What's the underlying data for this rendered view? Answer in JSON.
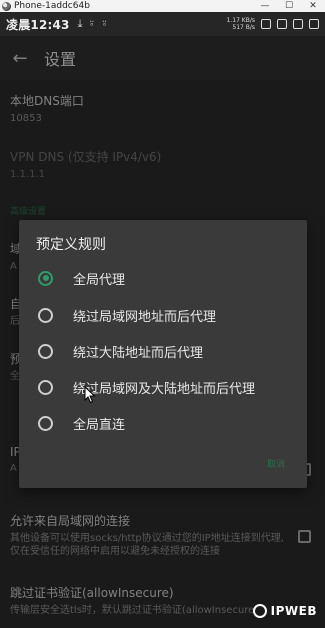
{
  "window": {
    "title": "Phone-1addc64b",
    "minimize": "—",
    "maximize": "☐",
    "close": "✕"
  },
  "status_bar": {
    "time": "凌晨12:43",
    "icons": [
      "download-icon",
      "cat-icon",
      "cat-icon"
    ],
    "speed_up": "1.17 KB/s",
    "speed_down": "517 B/s"
  },
  "app_bar": {
    "back": "←",
    "title": "设置"
  },
  "settings": [
    {
      "title": "本地DNS端口",
      "summary": "10853"
    },
    {
      "title": "VPN DNS (仅支持 IPv4/v6)",
      "summary": "1.1.1.1"
    },
    {
      "section": "高级设置"
    },
    {
      "title": "域",
      "summary": "A"
    },
    {
      "title": "自",
      "summary": "后"
    },
    {
      "title": "预",
      "summary": "全"
    },
    {
      "title": "IP",
      "summary": "A"
    },
    {
      "title": "允许来自局域网的连接",
      "summary": "其他设备可以使用socks/http协议通过您的IP地址连接到代理,仅在受信任的网络中启用以避免未经授权的连接"
    },
    {
      "title": "跳过证书验证(allowInsecure)",
      "summary": "传输层安全选tls时，默认跳过证书验证(allowInsecure"
    }
  ],
  "dialog": {
    "title": "预定义规则",
    "options": [
      {
        "label": "全局代理",
        "selected": true
      },
      {
        "label": "绕过局域网地址而后代理",
        "selected": false
      },
      {
        "label": "绕过大陆地址而后代理",
        "selected": false
      },
      {
        "label": "绕过局域网及大陆地址而后代理",
        "selected": false
      },
      {
        "label": "全局直连",
        "selected": false
      }
    ],
    "button": "取消"
  },
  "watermark": "IPWEB",
  "colors": {
    "accent": "#2e9b6a",
    "dialog_bg": "#3a3a3a",
    "background": "#2b2b2b"
  }
}
